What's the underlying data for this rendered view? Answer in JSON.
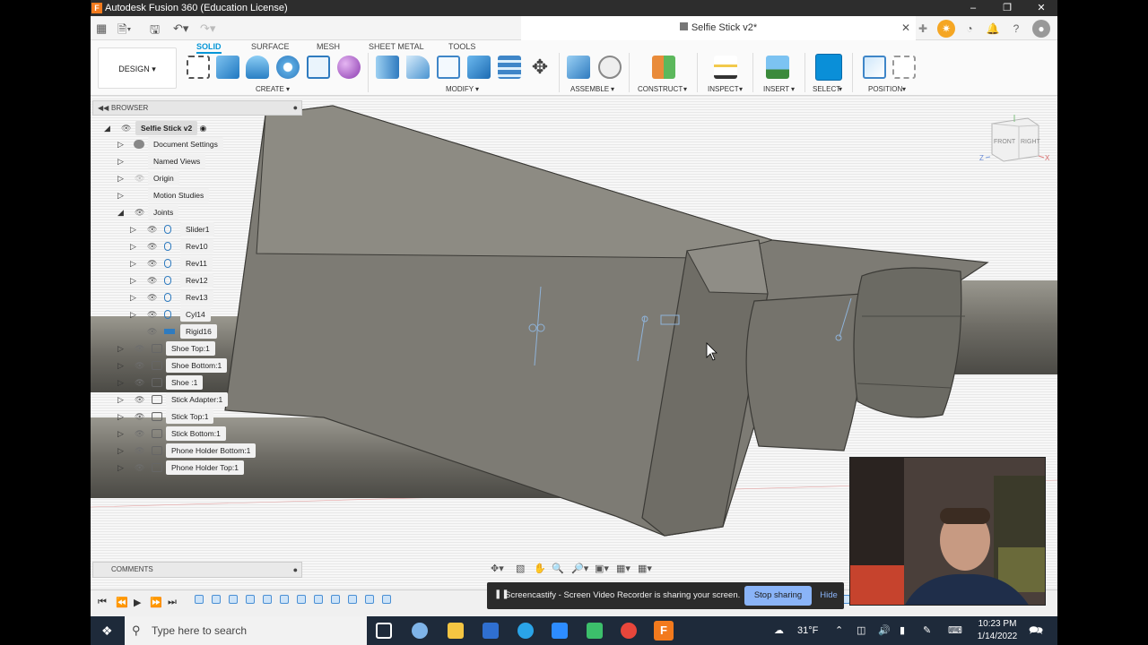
{
  "window": {
    "title": "Autodesk Fusion 360 (Education License)"
  },
  "document": {
    "title": "Selfie Stick v2*"
  },
  "ribbon": {
    "workspace": "DESIGN",
    "tabs": [
      "SOLID",
      "SURFACE",
      "MESH",
      "SHEET METAL",
      "TOOLS"
    ],
    "groups": [
      "CREATE",
      "MODIFY",
      "ASSEMBLE",
      "CONSTRUCT",
      "INSPECT",
      "INSERT",
      "SELECT",
      "POSITION"
    ]
  },
  "browser": {
    "header": "BROWSER",
    "root": "Selfie Stick v2",
    "items": [
      "Document Settings",
      "Named Views",
      "Origin",
      "Motion Studies",
      "Joints",
      "Slider1",
      "Rev10",
      "Rev11",
      "Rev12",
      "Rev13",
      "Cyl14",
      "Rigid16",
      "Shoe Top:1",
      "Shoe Bottom:1",
      "Shoe :1",
      "Stick Adapter:1",
      "Stick Top:1",
      "Stick Bottom:1",
      "Phone Holder Bottom:1",
      "Phone Holder Top:1"
    ]
  },
  "viewcube": {
    "front": "FRONT",
    "right": "RIGHT",
    "z": "Z",
    "x": "X"
  },
  "comments": {
    "header": "COMMENTS"
  },
  "screencast": {
    "message": "Screencastify - Screen Video Recorder is sharing your screen.",
    "stop": "Stop sharing",
    "hide": "Hide"
  },
  "taskbar": {
    "search_placeholder": "Type here to search",
    "weather": "31°F",
    "time": "10:23 PM",
    "date": "1/14/2022"
  },
  "colors": {
    "accent": "#0696d7",
    "model": "#7d7b74",
    "brand": "#f27a1d"
  }
}
